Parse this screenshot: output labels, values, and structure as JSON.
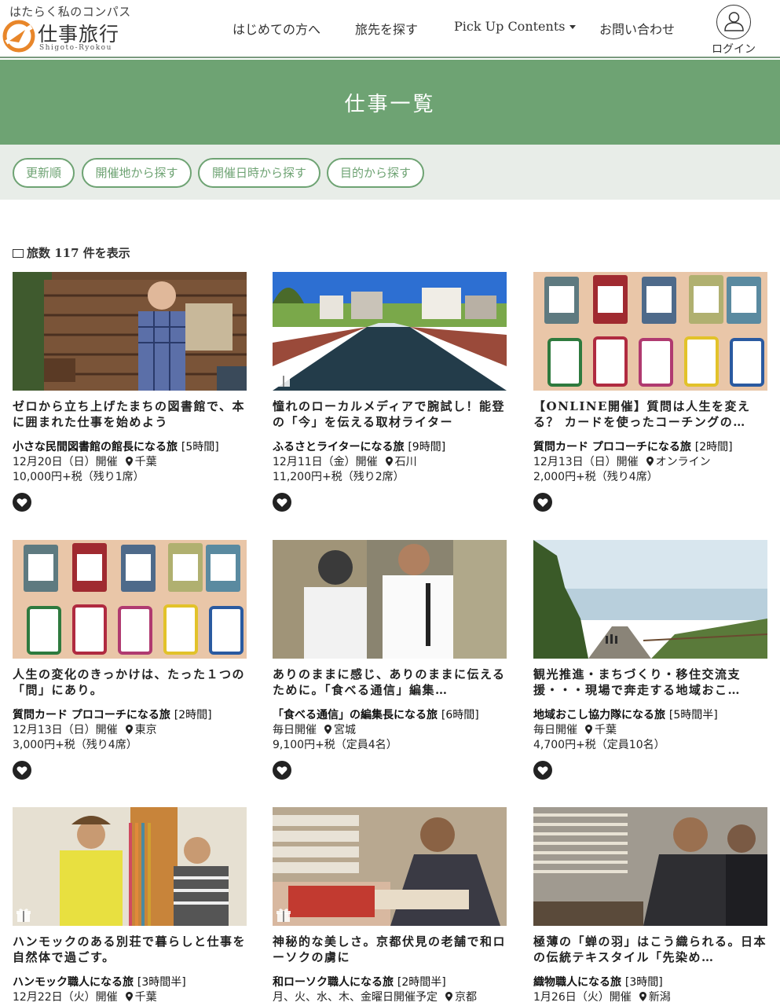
{
  "header": {
    "logo_tagline": "はたらく私のコンパス",
    "logo_name": "仕事旅行",
    "logo_roman": "Shigoto-Ryokou",
    "nav": [
      {
        "label": "はじめての方へ"
      },
      {
        "label": "旅先を探す"
      },
      {
        "label": "Pick Up Contents"
      },
      {
        "label": "お問い合わせ"
      }
    ],
    "login_label": "ログイン"
  },
  "banner": {
    "title": "仕事一覧"
  },
  "filters": [
    {
      "label": "更新順"
    },
    {
      "label": "開催地から探す"
    },
    {
      "label": "開催日時から探す"
    },
    {
      "label": "目的から探す"
    }
  ],
  "result_count": "旅数 117 件を表示",
  "cards": [
    {
      "lead": "ゼロから立ち上げたまちの図書館で、本に囲まれた仕事を始めよう",
      "title": "小さな民間図書館の館長になる旅",
      "duration": "[5時間]",
      "date": "12月20日（日）開催",
      "location": "千葉",
      "price": "10,000円+税（残り1席）",
      "image": "wooden-house",
      "gift": false
    },
    {
      "lead": "憧れのローカルメディアで腕試し！能登の「今」を伝える取材ライター",
      "title": "ふるさとライターになる旅",
      "duration": "[9時間]",
      "date": "12月11日（金）開催",
      "location": "石川",
      "price": "11,200円+税（残り2席）",
      "image": "canal",
      "gift": true
    },
    {
      "lead": "【ONLINE開催】質問は人生を変える？ カードを使ったコーチングの…",
      "title": "質問カード プロコーチになる旅",
      "duration": "[2時間]",
      "date": "12月13日（日）開催",
      "location": "オンライン",
      "price": "2,000円+税（残り4席）",
      "image": "cards",
      "gift": false
    },
    {
      "lead": "人生の変化のきっかけは、たった１つの「問」にあり。",
      "title": "質問カード プロコーチになる旅",
      "duration": "[2時間]",
      "date": "12月13日（日）開催",
      "location": "東京",
      "price": "3,000円+税（残り4席）",
      "image": "cards",
      "gift": false
    },
    {
      "lead": "ありのままに感じ、ありのままに伝えるために。「食べる通信」編集…",
      "title": "「食べる通信」の編集長になる旅",
      "duration": "[6時間]",
      "date": "毎日開催",
      "location": "宮城",
      "price": "9,100円+税（定員4名）",
      "image": "two-men",
      "gift": false
    },
    {
      "lead": "観光推進・まちづくり・移住交流支援・・・現場で奔走する地域おこ…",
      "title": "地域おこし協力隊になる旅",
      "duration": "[5時間半]",
      "date": "毎日開催",
      "location": "千葉",
      "price": "4,700円+税（定員10名）",
      "image": "coast",
      "gift": false
    },
    {
      "lead": "ハンモックのある別荘で暮らしと仕事を自然体で過ごす。",
      "title": "ハンモック職人になる旅",
      "duration": "[3時間半]",
      "date": "12月22日（火）開催",
      "location": "千葉",
      "price": "",
      "image": "hammock",
      "gift": true
    },
    {
      "lead": "神秘的な美しさ。京都伏見の老舗で和ローソクの虜に",
      "title": "和ローソク職人になる旅",
      "duration": "[2時間半]",
      "date": "月、火、水、木、金曜日開催予定",
      "location": "京都",
      "price": "",
      "image": "candle",
      "gift": true
    },
    {
      "lead": "極薄の「蝉の羽」はこう織られる。日本の伝統テキスタイル「先染め…",
      "title": "織物職人になる旅",
      "duration": "[3時間]",
      "date": "1月26日（火）開催",
      "location": "新潟",
      "price": "",
      "image": "weaver",
      "gift": false
    }
  ],
  "colors": {
    "brand_green": "#6ea373",
    "filter_bg": "#e8ede8",
    "logo_orange": "#e8862a"
  }
}
